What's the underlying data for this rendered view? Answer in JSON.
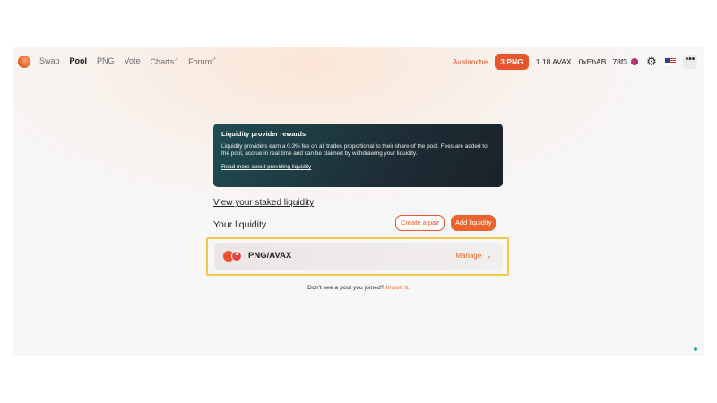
{
  "nav": {
    "items": [
      {
        "label": "Swap",
        "active": false,
        "ext": ""
      },
      {
        "label": "Pool",
        "active": true,
        "ext": ""
      },
      {
        "label": "PNG",
        "active": false,
        "ext": ""
      },
      {
        "label": "Vote",
        "active": false,
        "ext": ""
      },
      {
        "label": "Charts",
        "active": false,
        "ext": "↗"
      },
      {
        "label": "Forum",
        "active": false,
        "ext": "↗"
      }
    ]
  },
  "header": {
    "network": "Avalanche",
    "png_badge": "3 PNG",
    "avax_balance": "1.18 AVAX",
    "address": "0xEbAB...78f3",
    "settings_icon": "gear-icon",
    "language_icon": "us-flag-icon",
    "more_label": "•••"
  },
  "rewards": {
    "title": "Liquidity provider rewards",
    "body": "Liquidity providers earn a 0.3% fee on all trades proportional to their share of the pool. Fees are added to the pool, accrue in real time and can be claimed by withdrawing your liquidity.",
    "link": "Read more about providing liquidity"
  },
  "liquidity": {
    "staked_link": "View your staked liquidity",
    "title": "Your liquidity",
    "create_pair": "Create a pair",
    "add_liquidity": "Add liquidity",
    "pools": [
      {
        "name": "PNG/AVAX",
        "manage_label": "Manage"
      }
    ],
    "import_prefix": "Don't see a pool you joined?",
    "import_link": "Import it."
  },
  "colors": {
    "accent": "#e8542b",
    "highlight": "#f1c94a",
    "card_dark": "#1e2d36"
  }
}
